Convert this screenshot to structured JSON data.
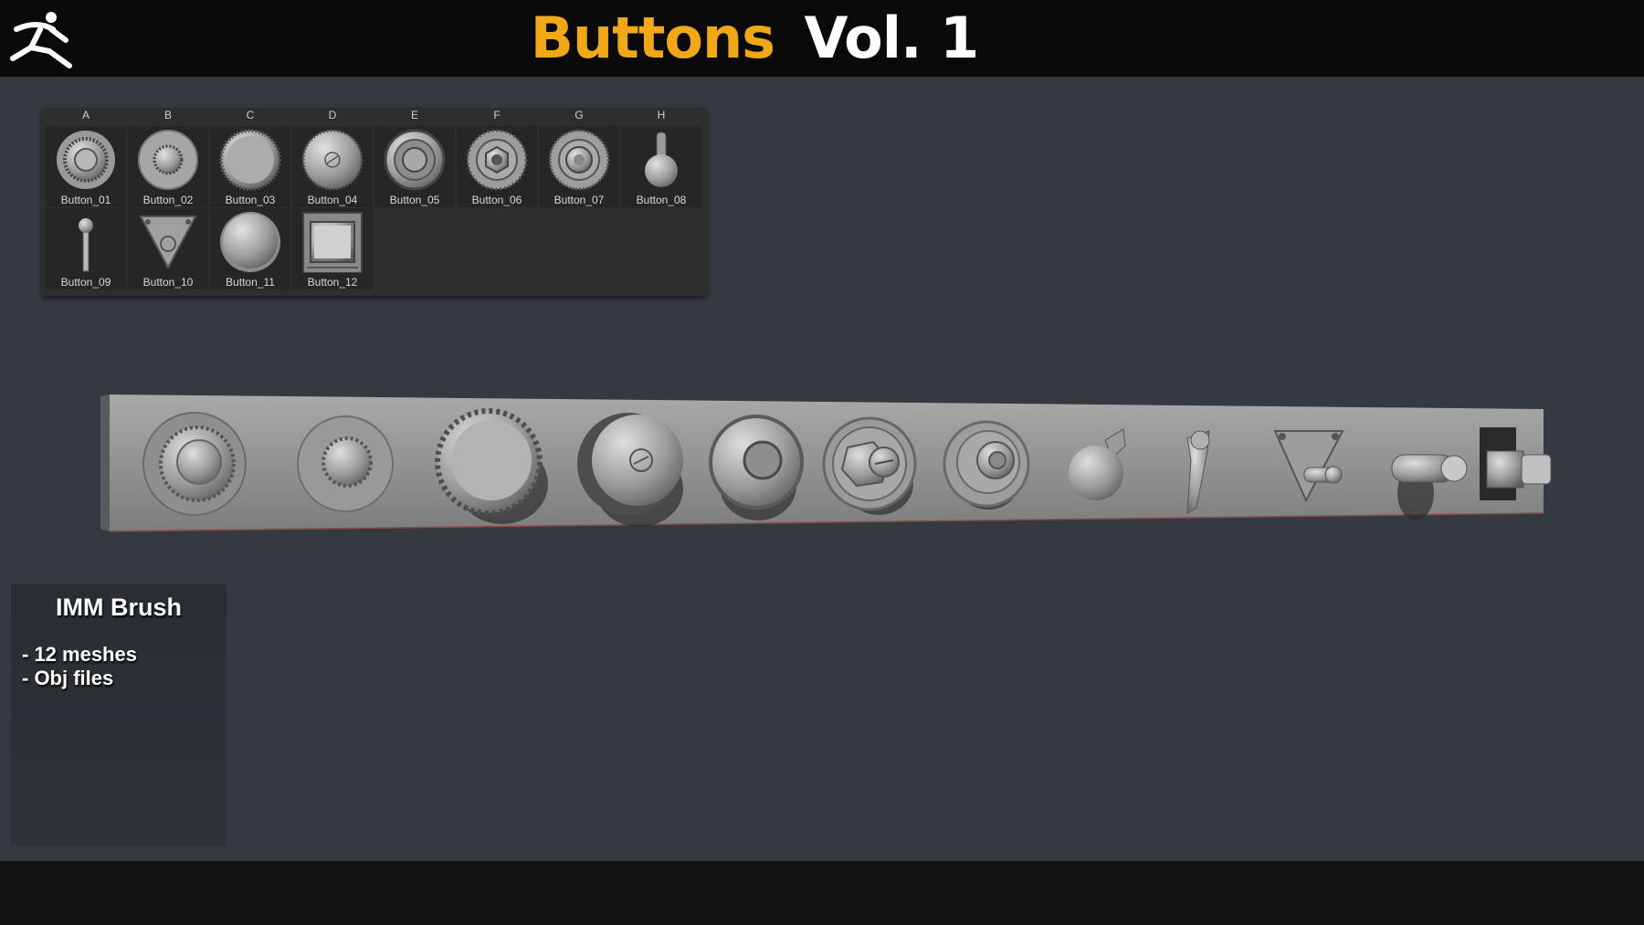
{
  "header": {
    "title_main": "Buttons",
    "title_vol": "Vol. 1",
    "title_main_color": "#f0a818",
    "title_vol_color": "#ffffff",
    "logo_icon": "zbrush-runner-logo"
  },
  "palette": {
    "columns": [
      "A",
      "B",
      "C",
      "D",
      "E",
      "F",
      "G",
      "H"
    ],
    "items": [
      {
        "label": "Button_01",
        "icon": "knurled-dial-icon"
      },
      {
        "label": "Button_02",
        "icon": "small-knob-icon"
      },
      {
        "label": "Button_03",
        "icon": "flat-knurled-cap-icon"
      },
      {
        "label": "Button_04",
        "icon": "slotted-cap-icon"
      },
      {
        "label": "Button_05",
        "icon": "ring-button-icon"
      },
      {
        "label": "Button_06",
        "icon": "hex-nut-button-icon"
      },
      {
        "label": "Button_07",
        "icon": "stepped-ring-icon"
      },
      {
        "label": "Button_08",
        "icon": "ball-lever-icon"
      },
      {
        "label": "Button_09",
        "icon": "toggle-lever-icon"
      },
      {
        "label": "Button_10",
        "icon": "triangle-plate-icon"
      },
      {
        "label": "Button_11",
        "icon": "sphere-button-icon"
      },
      {
        "label": "Button_12",
        "icon": "square-rocker-icon"
      }
    ]
  },
  "preview": {
    "icon": "buttons-preview-strip",
    "item_count": 12
  },
  "info": {
    "title": "IMM Brush",
    "items": [
      "- 12 meshes",
      "- Obj files"
    ]
  },
  "colors": {
    "background": "#343a40",
    "header_bg": "#0a0a0a",
    "footer_bg": "#131313",
    "accent": "#f0a818"
  }
}
